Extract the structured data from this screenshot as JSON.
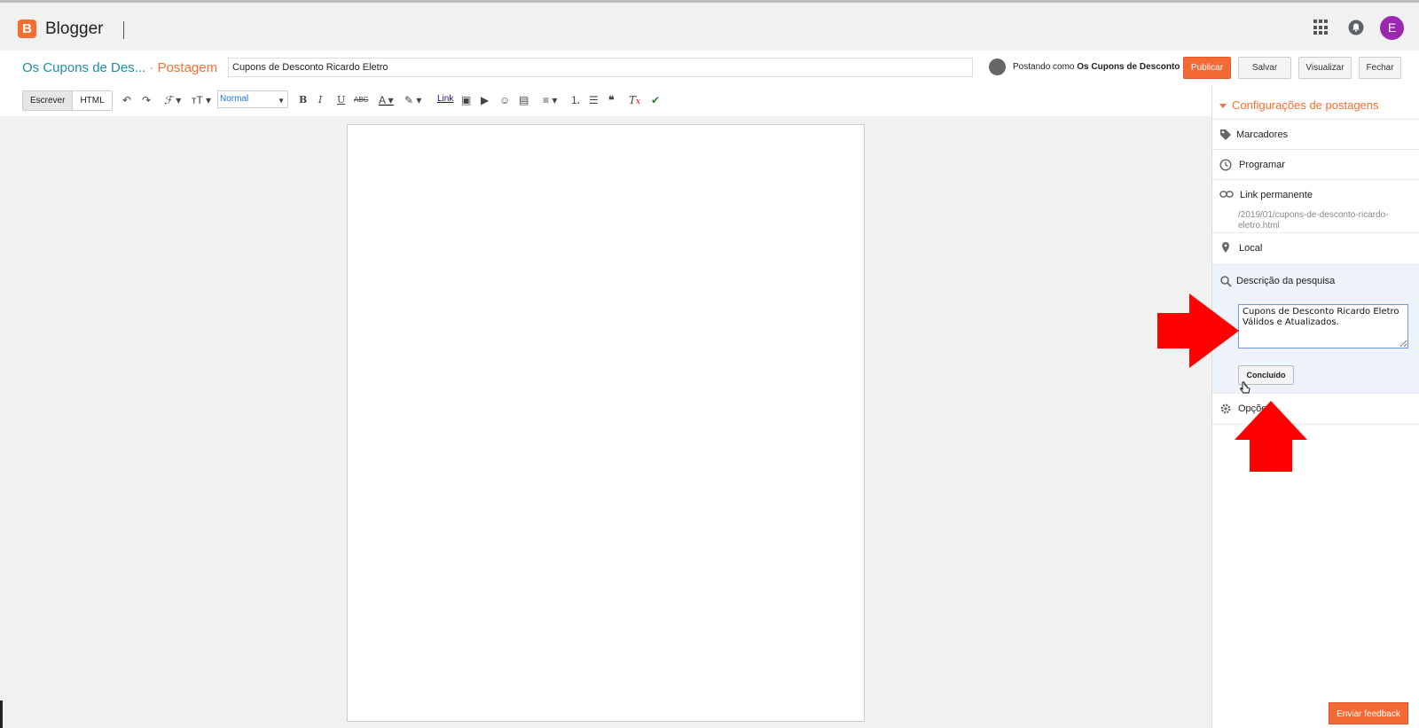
{
  "app": {
    "name": "Blogger",
    "avatar_letter": "E"
  },
  "post_header": {
    "blog_name": "Os Cupons de Des...",
    "separator": "·",
    "section": "Postagem",
    "title_value": "Cupons de Desconto Ricardo Eletro",
    "posting_as_prefix": "Postando como",
    "posting_as_name": "Os Cupons de Desconto",
    "buttons": {
      "publish": "Publicar",
      "save": "Salvar",
      "preview": "Visualizar",
      "close": "Fechar"
    }
  },
  "toolbar": {
    "mode_compose": "Escrever",
    "mode_html": "HTML",
    "format_value": "Normal",
    "link_label": "Link"
  },
  "sidebar": {
    "title": "Configurações de postagens",
    "items": {
      "labels": "Marcadores",
      "schedule": "Programar",
      "permalink": "Link permanente",
      "permalink_value": "/2019/01/cupons-de-desconto-ricardo-eletro.html",
      "location": "Local",
      "search_description": "Descrição da pesquisa",
      "search_description_value": "Cupons de Desconto Ricardo Eletro Válidos e Atualizados.",
      "done": "Concluído",
      "options": "Opções"
    }
  },
  "feedback_label": "Enviar feedback",
  "colors": {
    "accent": "#f46f30",
    "link": "#1e8ea1",
    "annotation": "#ff0000",
    "avatar": "#9c27b0"
  }
}
